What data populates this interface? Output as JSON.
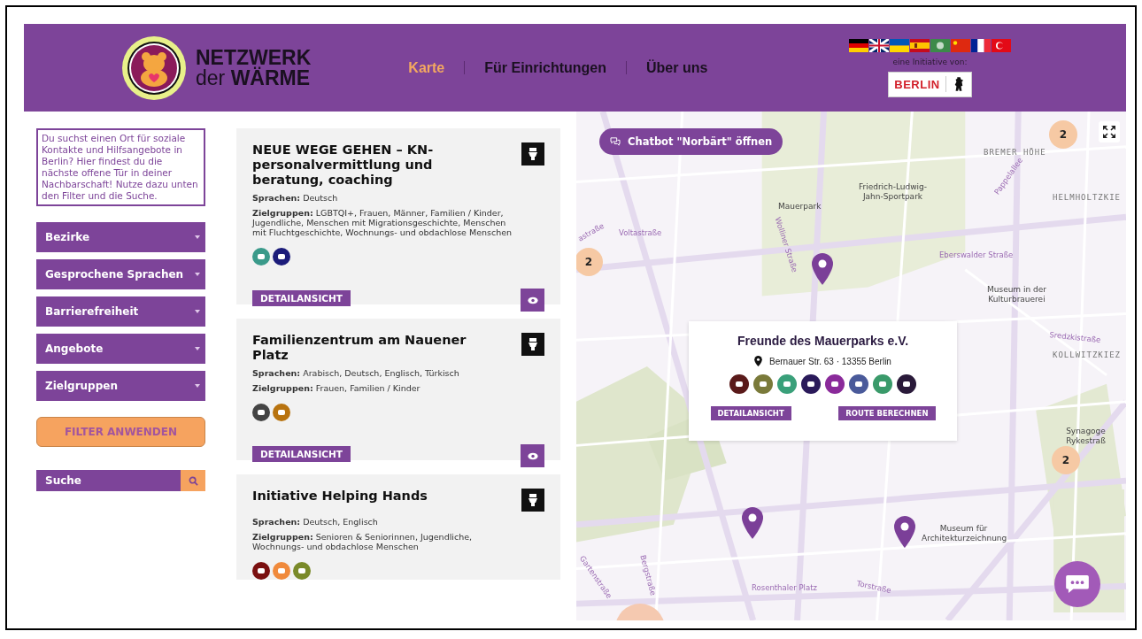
{
  "header": {
    "logo": {
      "line1": "NETZWERK",
      "line2_light": "der",
      "line2_bold": "WÄRME"
    },
    "nav": [
      {
        "label": "Karte",
        "selected": true
      },
      {
        "label": "Für Einrichtungen",
        "selected": false
      },
      {
        "label": "Über uns",
        "selected": false
      }
    ],
    "languages": [
      {
        "kind": "de"
      },
      {
        "kind": "gb"
      },
      {
        "kind": "ua"
      },
      {
        "kind": "es"
      },
      {
        "kind": "ar"
      },
      {
        "kind": "cn"
      },
      {
        "kind": "fr"
      },
      {
        "kind": "tr"
      }
    ],
    "initiative_label": "eine Initiative von:",
    "partner": "BERLIN"
  },
  "sidebar": {
    "intro": "Du suchst einen Ort für soziale Kontakte und Hilfsangebote in Berlin? Hier findest du die nächste offene Tür in deiner Nachbarschaft! Nutze dazu unten den Filter und die Suche.",
    "filters": [
      "Bezirke",
      "Gesprochene Sprachen",
      "Barrierefreiheit",
      "Angebote",
      "Zielgruppen"
    ],
    "apply_button": "FILTER ANWENDEN",
    "search": {
      "placeholder": "Suche"
    }
  },
  "cards": [
    {
      "title": "NEUE WEGE GEHEN – KN-personalvermittlung und beratung, coaching",
      "languages": "**Sprachen:** Deutsch",
      "groups": "**Zielgruppen:** LGBTQI+, Frauen, Männer, Familien / Kinder, Jugendliche, Menschen mit Migrationsgeschichte, Menschen mit Fluchtgeschichte, Wochnungs- und obdachlose Menschen",
      "categories": [
        {
          "color": "#3a9a8a"
        },
        {
          "color": "#1c1c7a"
        }
      ],
      "detail_button": "DETAILANSICHT"
    },
    {
      "title": "Familienzentrum am Nauener Platz",
      "languages": "**Sprachen:** Arabisch, Deutsch, Englisch, Türkisch",
      "groups": "**Zielgruppen:** Frauen, Familien / Kinder",
      "categories": [
        {
          "color": "#444444"
        },
        {
          "color": "#b8730f"
        }
      ],
      "detail_button": "DETAILANSICHT"
    },
    {
      "title": "Initiative Helping Hands",
      "languages": "**Sprachen:** Deutsch, Englisch",
      "groups": "**Zielgruppen:** Senioren & Seniorinnen, Jugendliche, Wochnungs- und obdachlose Menschen",
      "categories": [
        {
          "color": "#7a1010"
        },
        {
          "color": "#f08a3c"
        },
        {
          "color": "#7a8a2a"
        }
      ]
    }
  ],
  "map": {
    "chatbot_button": "Chatbot \"Norbärt\" öffnen",
    "clusters": [
      "2",
      "2",
      "2"
    ],
    "labels": [
      {
        "text": "BREMER HÖHE",
        "kind": "district"
      },
      {
        "text": "Mauerpark",
        "kind": "poi"
      },
      {
        "text": "Friedrich-Ludwig-Jahn-Sportpark",
        "kind": "poi"
      },
      {
        "text": "HELMHOLTZKIE",
        "kind": "district"
      },
      {
        "text": "Voltastraße",
        "kind": "street"
      },
      {
        "text": "astraße",
        "kind": "street"
      },
      {
        "text": "Wolliner Straße",
        "kind": "street"
      },
      {
        "text": "Pappelallee",
        "kind": "street"
      },
      {
        "text": "Eberswalder Straße",
        "kind": "street"
      },
      {
        "text": "Museum in der Kulturbrauerei",
        "kind": "poi"
      },
      {
        "text": "Sredzkistraße",
        "kind": "street"
      },
      {
        "text": "KOLLWITZKIEZ",
        "kind": "district"
      },
      {
        "text": "Synagoge Rykestraß",
        "kind": "poi"
      },
      {
        "text": "Museum für Architekturzeichnung",
        "kind": "poi"
      },
      {
        "text": "Bergstraße",
        "kind": "street"
      },
      {
        "text": "Gartenstraße",
        "kind": "street"
      },
      {
        "text": "Rosenthaler Platz",
        "kind": "street"
      },
      {
        "text": "Torstraße",
        "kind": "street"
      }
    ],
    "popup": {
      "title": "Freunde des Mauerparks e.V.",
      "address": "Bernauer Str. 63 · 13355 Berlin",
      "categories": [
        {
          "color": "#5a1a1a"
        },
        {
          "color": "#7a7a3a"
        },
        {
          "color": "#3aa07a"
        },
        {
          "color": "#2a1a5a"
        },
        {
          "color": "#8a2a9a"
        },
        {
          "color": "#4a5a9a"
        },
        {
          "color": "#3a9a6a"
        },
        {
          "color": "#2a1a3a"
        }
      ],
      "buttons": [
        "DETAILANSICHT",
        "ROUTE BERECHNEN"
      ]
    }
  }
}
